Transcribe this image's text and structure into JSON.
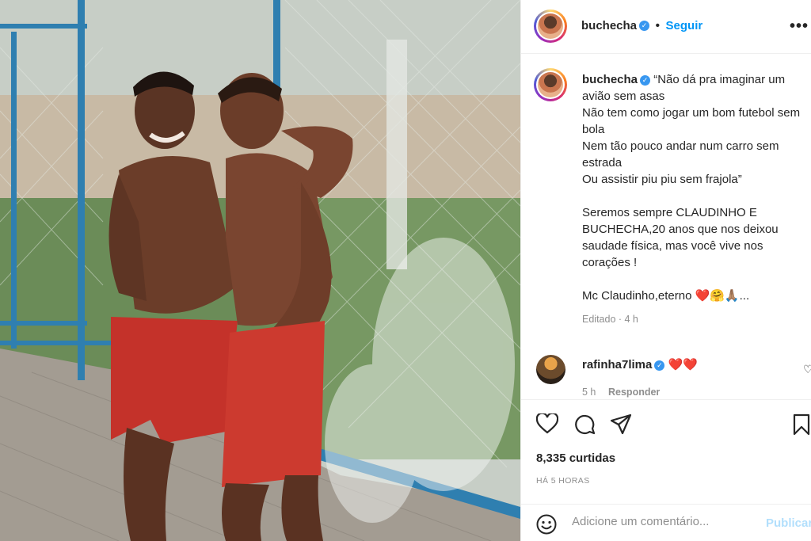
{
  "post": {
    "username": "buchecha",
    "follow_label": "Seguir",
    "separator": "•",
    "more_label": "•••",
    "verified_glyph": "✓"
  },
  "caption": {
    "username": "buchecha",
    "lines": [
      "“Não dá pra imaginar um avião sem asas",
      "Não tem como jogar um bom futebol sem bola",
      "Nem tão pouco andar num carro sem estrada",
      "Ou assistir piu piu sem frajola”"
    ],
    "paragraph2": "Seremos sempre CLAUDINHO E BUCHECHA,20 anos que nos deixou saudade física, mas você vive nos corações !",
    "signoff": "Mc Claudinho,eterno ❤️🤗🙏🏽...",
    "edited": "Editado · 4 h"
  },
  "comment": {
    "username": "rafinha7lima",
    "text": "❤️❤️",
    "time": "5 h",
    "reply_label": "Responder",
    "like_glyph": "♡"
  },
  "actions": {
    "icons": [
      "heart-icon",
      "comment-icon",
      "share-icon",
      "bookmark-icon"
    ],
    "likes": "8,335 curtidas",
    "time_ago": "HÁ 5 HORAS"
  },
  "add_comment": {
    "placeholder": "Adicione um comentário...",
    "publish_label": "Publicar",
    "emoji_icon": "smile-icon"
  },
  "colors": {
    "link_blue": "#0095f6",
    "verified_blue": "#3897f0",
    "publish_disabled": "#b2dffc",
    "heart_red": "#ed4956"
  }
}
